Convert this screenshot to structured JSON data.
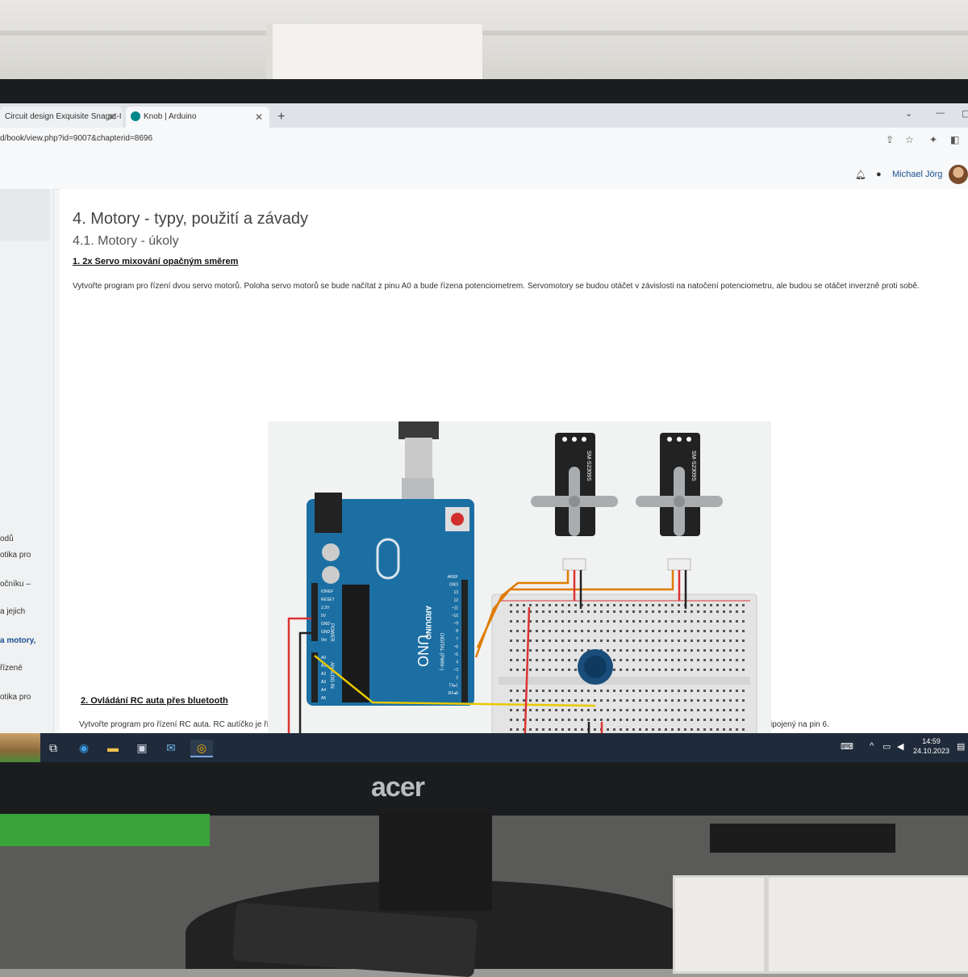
{
  "browser": {
    "tabs": [
      {
        "label": "Circuit design Exquisite Snaget-I"
      },
      {
        "label": "Knob | Arduino"
      }
    ],
    "url": "d/book/view.php?id=9007&chapterid=8696"
  },
  "user": {
    "name": "Michael Jörg"
  },
  "sidebar": {
    "items": [
      {
        "label": "odů"
      },
      {
        "label": "otika pro"
      },
      {
        "label": "očníku –"
      },
      {
        "label": "a jejich"
      },
      {
        "label": "a motory,"
      },
      {
        "label": "řízené"
      },
      {
        "label": "otika pro"
      }
    ]
  },
  "content": {
    "chapter_title": "4. Motory - typy, použití a závady",
    "subchapter_title": "4.1. Motory - úkoly",
    "task1_heading": "1. 2x Servo mixování opačným směrem",
    "task1_text": "Vytvořte program pro řízení dvou servo motorů. Poloha servo motorů se bude načítat z pinu A0 a bude řízena potenciometrem. Servomotory se budou otáčet v závislosti na natočení potenciometru, ale budou se otáčet inverzně proti sobě.",
    "task2_heading": "2. Ovládání RC auta přes bluetooth",
    "task2_text": "Vytvořte program pro řízení RC auta. RC autíčko je řízeno dvěma signály pro servo motory. „Sz“ je servo zatáčení připojené na pinu 5. „Sp“ je řídící signál pro RC regulátor DC motoru, který je připojený na pin 6."
  },
  "diagram": {
    "board_brand": "ARDUINO",
    "board_model": "UNO",
    "servo_label": "SM-S2309S",
    "power_label": "POWER",
    "analog_label": "ANALOG IN",
    "digital_label": "DIGITAL (PWM~)",
    "power_pins": [
      "IOREF",
      "RESET",
      "3.3V",
      "5V",
      "GND",
      "GND",
      "Vin"
    ],
    "analog_pins": [
      "A0",
      "A1",
      "A2",
      "A3",
      "A4",
      "A5"
    ],
    "digital_pins": [
      "AREF",
      "GND",
      "13",
      "12",
      "~11",
      "~10",
      "~9",
      "8",
      "7",
      "~6",
      "~5",
      "4",
      "~3",
      "2",
      "TX▸1",
      "RX◂0"
    ]
  },
  "taskbar": {
    "time": "14:59",
    "date": "24.10.2023"
  },
  "monitor": {
    "brand": "acer"
  }
}
